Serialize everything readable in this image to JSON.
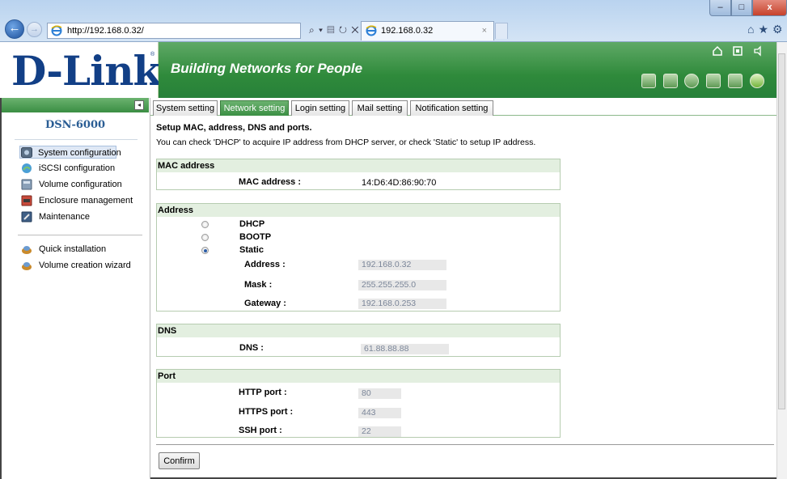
{
  "browser": {
    "window_buttons": {
      "minimize": "–",
      "maximize": "□",
      "close": "x"
    },
    "back_icon": "←",
    "forward_icon": "→",
    "address": "http://192.168.0.32/",
    "address_controls": "⌕ ▾ ▤ ↻ ✕",
    "active_tab_title": "192.168.0.32",
    "tab_close": "×",
    "right_icons": "⌂★⚙"
  },
  "header": {
    "logo": "D-Link",
    "logo_reg": "®",
    "tagline": "Building Networks for People",
    "top_icons": [
      "home-icon",
      "help-icon",
      "logout-icon"
    ],
    "tool_icons": [
      "database-icon",
      "tools-icon",
      "globe-icon",
      "disk-icon",
      "monitor-icon",
      "power-icon"
    ],
    "accent_color": "#2f8a3b"
  },
  "sidebar": {
    "collapse": "◂",
    "device_name": "DSN-6000",
    "items": [
      {
        "label": "System configuration",
        "icon": "system-config-icon",
        "selected": true
      },
      {
        "label": "iSCSI configuration",
        "icon": "iscsi-icon"
      },
      {
        "label": "Volume configuration",
        "icon": "volume-icon"
      },
      {
        "label": "Enclosure management",
        "icon": "enclosure-icon"
      },
      {
        "label": "Maintenance",
        "icon": "maintenance-icon"
      }
    ],
    "quick_items": [
      {
        "label": "Quick installation",
        "icon": "quick-install-icon"
      },
      {
        "label": "Volume creation wizard",
        "icon": "wizard-icon"
      }
    ]
  },
  "tabs": [
    {
      "label": "System setting"
    },
    {
      "label": "Network setting",
      "active": true
    },
    {
      "label": "Login setting"
    },
    {
      "label": "Mail setting"
    },
    {
      "label": "Notification setting"
    }
  ],
  "main": {
    "title": "Setup MAC, address, DNS and ports.",
    "description": "You can check 'DHCP' to acquire IP address from DHCP server, or check 'Static' to setup IP address.",
    "mac": {
      "heading": "MAC address",
      "label": "MAC address :",
      "value": "14:D6:4D:86:90:70"
    },
    "address": {
      "heading": "Address",
      "options": [
        "DHCP",
        "BOOTP",
        "Static"
      ],
      "selected": "Static",
      "address_label": "Address :",
      "address_value": "192.168.0.32",
      "mask_label": "Mask :",
      "mask_value": "255.255.255.0",
      "gateway_label": "Gateway :",
      "gateway_value": "192.168.0.253"
    },
    "dns": {
      "heading": "DNS",
      "label": "DNS :",
      "value": "61.88.88.88"
    },
    "port": {
      "heading": "Port",
      "http_label": "HTTP port :",
      "http_value": "80",
      "https_label": "HTTPS port :",
      "https_value": "443",
      "ssh_label": "SSH port :",
      "ssh_value": "22"
    },
    "confirm_label": "Confirm"
  }
}
